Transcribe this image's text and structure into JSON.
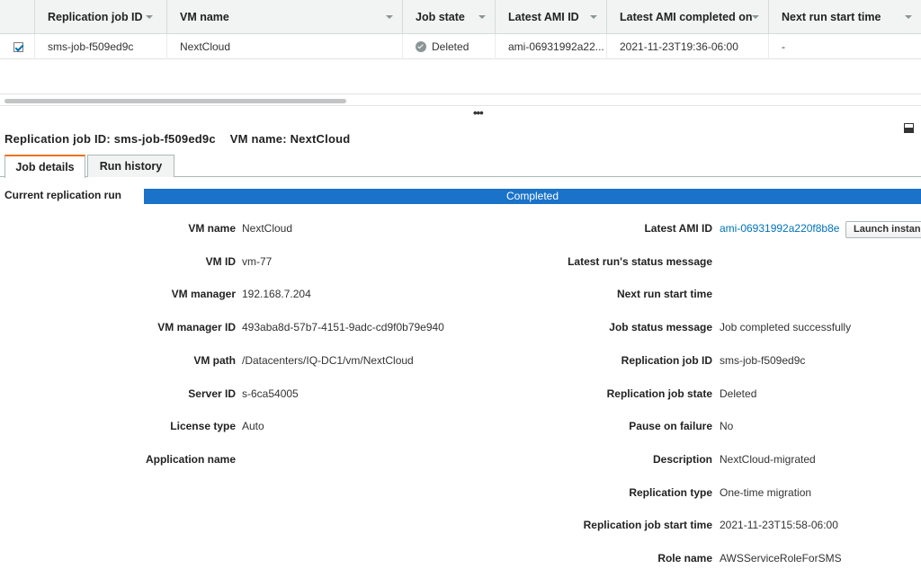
{
  "table": {
    "headers": {
      "replication_job_id": "Replication job ID",
      "vm_name": "VM name",
      "job_state": "Job state",
      "latest_ami_id": "Latest AMI ID",
      "latest_ami_completed_on": "Latest AMI completed on",
      "next_run_start_time": "Next run start time"
    },
    "row": {
      "replication_job_id": "sms-job-f509ed9c",
      "vm_name": "NextCloud",
      "job_state": "Deleted",
      "latest_ami_id": "ami-06931992a22...",
      "latest_ami_completed_on": "2021-11-23T19:36-06:00",
      "next_run_start_time": "-"
    }
  },
  "split_handle": "•••",
  "detail": {
    "title_job": "Replication job ID: sms-job-f509ed9c",
    "title_vm": "VM name: NextCloud"
  },
  "tabs": {
    "job_details": "Job details",
    "run_history": "Run history"
  },
  "current_run": {
    "label": "Current replication run",
    "status": "Completed",
    "progress_percent": 100
  },
  "left_fields": [
    {
      "label": "VM name",
      "value": "NextCloud"
    },
    {
      "label": "VM ID",
      "value": "vm-77"
    },
    {
      "label": "VM manager",
      "value": "192.168.7.204"
    },
    {
      "label": "VM manager ID",
      "value": "493aba8d-57b7-4151-9adc-cd9f0b79e940"
    },
    {
      "label": "VM path",
      "value": "/Datacenters/IQ-DC1/vm/NextCloud"
    },
    {
      "label": "Server ID",
      "value": "s-6ca54005"
    },
    {
      "label": "License type",
      "value": "Auto"
    },
    {
      "label": "Application name",
      "value": ""
    }
  ],
  "right_fields": [
    {
      "label": "Latest AMI ID",
      "value": "ami-06931992a220f8b8e"
    },
    {
      "label": "Latest run's status message",
      "value": ""
    },
    {
      "label": "Next run start time",
      "value": ""
    },
    {
      "label": "Job status message",
      "value": "Job completed successfully"
    },
    {
      "label": "Replication job ID",
      "value": "sms-job-f509ed9c"
    },
    {
      "label": "Replication job state",
      "value": "Deleted"
    },
    {
      "label": "Pause on failure",
      "value": "No"
    },
    {
      "label": "Description",
      "value": "NextCloud-migrated"
    },
    {
      "label": "Replication type",
      "value": "One-time migration"
    },
    {
      "label": "Replication job start time",
      "value": "2021-11-23T15:58-06:00"
    },
    {
      "label": "Role name",
      "value": "AWSServiceRoleForSMS"
    }
  ],
  "launch_button": "Launch instance",
  "colors": {
    "accent_tab": "#ec7211",
    "progress": "#1a73c9",
    "link": "#0073bb"
  }
}
